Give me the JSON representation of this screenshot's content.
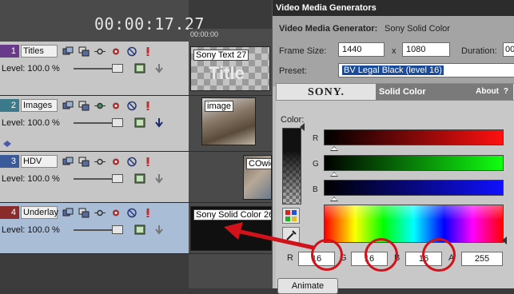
{
  "timeline": {
    "timecode": "00:00:17.27",
    "ruler_label": "00:00:00",
    "tracks": [
      {
        "number": "1",
        "name": "Titles",
        "level": "Level: 100.0 %",
        "color": "#6a3a8a"
      },
      {
        "number": "2",
        "name": "Images",
        "level": "Level: 100.0 %",
        "color": "#3a7a8a"
      },
      {
        "number": "3",
        "name": "HDV",
        "level": "Level: 100.0 %",
        "color": "#3a5a9a"
      },
      {
        "number": "4",
        "name": "Underlay",
        "level": "Level: 100.0 %",
        "color": "#8a2a2a"
      }
    ],
    "clips": [
      {
        "label": "Sony Text 27",
        "overlay_text": "Title"
      },
      {
        "label": "image"
      },
      {
        "label": "COwic"
      },
      {
        "label": "Sony Solid Color 26"
      }
    ]
  },
  "dialog": {
    "title": "Video Media Generators",
    "generator_label": "Video Media Generator:",
    "generator_value": "Sony Solid Color",
    "frame_size_label": "Frame Size:",
    "frame_width": "1440",
    "x_label": "x",
    "frame_height": "1080",
    "duration_label": "Duration:",
    "duration_value": "00",
    "preset_label": "Preset:",
    "preset_value": "BV Legal Black (level 16)",
    "plugin_brand": "SONY.",
    "plugin_name": "Solid Color",
    "about_label": "About",
    "help_label": "?",
    "color_label": "Color:",
    "channel_labels": [
      "R",
      "G",
      "B"
    ],
    "values": {
      "r_label": "R",
      "r": "16",
      "g_label": "G",
      "g": "16",
      "b_label": "B",
      "b": "16",
      "a_label": "A",
      "a": "255"
    },
    "animate_label": "Animate"
  },
  "colors": {
    "accent_red": "#d2121a",
    "selection_blue": "#1a4a9a"
  }
}
